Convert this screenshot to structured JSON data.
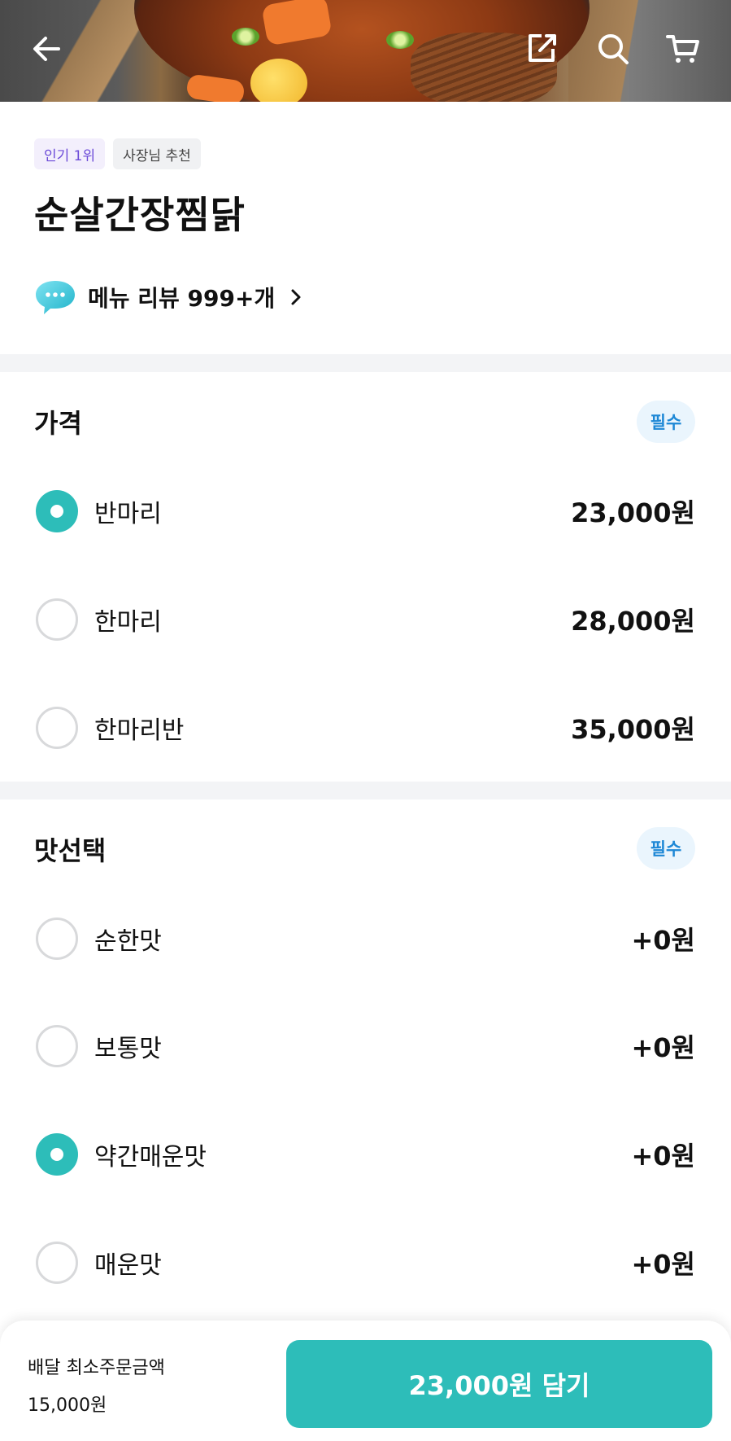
{
  "header": {
    "back_icon": "arrow-left-icon",
    "share_icon": "share-icon",
    "search_icon": "search-icon",
    "cart_icon": "cart-icon"
  },
  "badges": [
    "인기 1위",
    "사장님 추천"
  ],
  "menu": {
    "title": "순살간장찜닭",
    "review_text": "메뉴 리뷰 999+개"
  },
  "price_section": {
    "title": "가격",
    "required_label": "필수",
    "options": [
      {
        "label": "반마리",
        "price": "23,000원",
        "selected": true
      },
      {
        "label": "한마리",
        "price": "28,000원",
        "selected": false
      },
      {
        "label": "한마리반",
        "price": "35,000원",
        "selected": false
      }
    ]
  },
  "taste_section": {
    "title": "맛선택",
    "required_label": "필수",
    "options": [
      {
        "label": "순한맛",
        "price": "+0원",
        "selected": false
      },
      {
        "label": "보통맛",
        "price": "+0원",
        "selected": false
      },
      {
        "label": "약간매운맛",
        "price": "+0원",
        "selected": true
      },
      {
        "label": "매운맛",
        "price": "+0원",
        "selected": false
      }
    ]
  },
  "bottom": {
    "min_order_label": "배달 최소주문금액",
    "min_order_value": "15,000원",
    "cta_label": "23,000원 담기"
  },
  "colors": {
    "accent": "#2dbdb9",
    "required_bg": "#eaf5fd",
    "required_text": "#1e88d6",
    "badge_purple": "#6c4bd8"
  }
}
